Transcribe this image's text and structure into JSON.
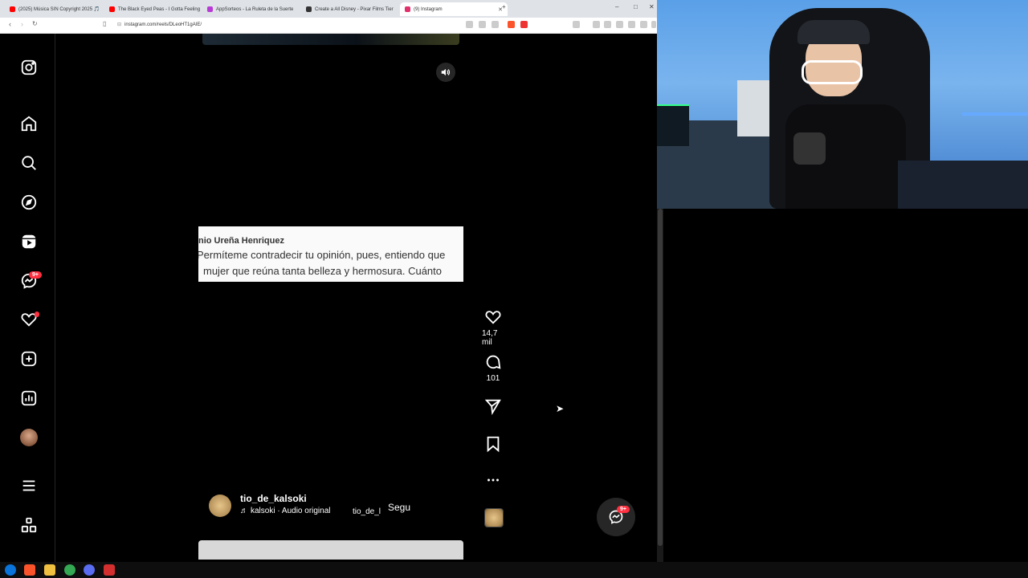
{
  "tabs": [
    {
      "label": "(2025) Música SIN Copyright 2025 🎵",
      "color": "#ff0000"
    },
    {
      "label": "The Black Eyed Peas - I Gotta Feeling",
      "color": "#ff0000"
    },
    {
      "label": "AppSorteos - La Ruleta de la Suerte",
      "color": "#b83ad6"
    },
    {
      "label": "Create a All Disney - Pixar Films Tier",
      "color": "#333333"
    },
    {
      "label": "(9) Instagram",
      "color": "#e1306c"
    }
  ],
  "address": {
    "url": "instagram.com/reels/DLeoHT1gAIE/"
  },
  "sidebar": {
    "icons": [
      "instagram-logo-icon",
      "home-icon",
      "search-icon",
      "explore-icon",
      "reels-icon",
      "messenger-icon",
      "heart-icon",
      "create-icon",
      "dashboard-icon",
      "profile-avatar",
      "menu-icon",
      "also-from-meta-icon"
    ],
    "messages_badge": "9+"
  },
  "reel": {
    "caption_name": "nio Ureña Henriquez",
    "caption_line1": "Permíteme contradecir tu opinión, pues, entiendo que",
    "caption_line2": "mujer que reúna tanta belleza y hermosura. Cuánto",
    "username": "tio_de_kalsoki",
    "audio": "kalsoki · Audio original",
    "audio_repeat": "tio_de_l",
    "follow": "Segu"
  },
  "actions": {
    "likes": "14,7 mil",
    "comments": "101"
  },
  "messenger_badge": "9+",
  "colors": {
    "accent_red": "#ff3040",
    "bg": "#000000"
  }
}
